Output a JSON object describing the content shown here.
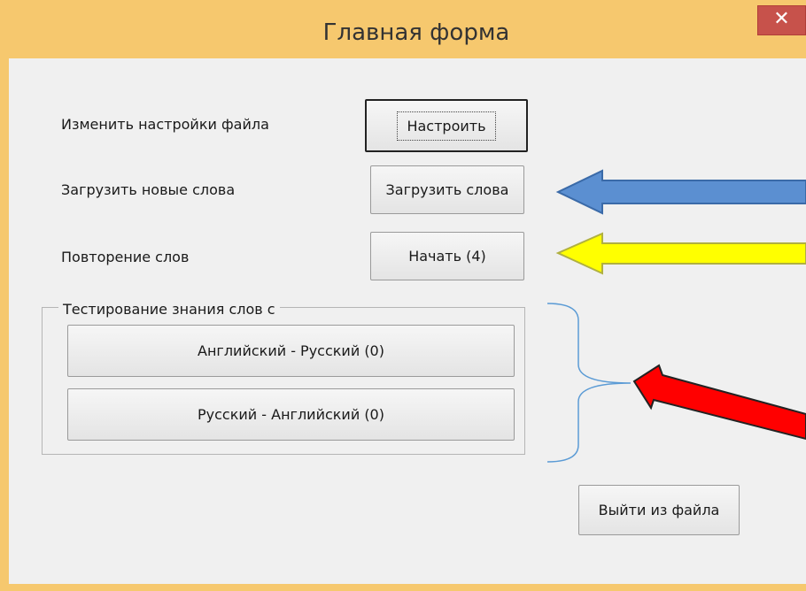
{
  "window": {
    "title": "Главная форма",
    "close_glyph": "✕"
  },
  "rows": {
    "settings_label": "Изменить настройки файла",
    "settings_button": "Настроить",
    "load_label": "Загрузить новые слова",
    "load_button": "Загрузить слова",
    "repeat_label": "Повторение слов",
    "repeat_button": "Начать (4)"
  },
  "test_group": {
    "legend": "Тестирование знания слов с",
    "en_ru_button": "Английский - Русский (0)",
    "ru_en_button": "Русский - Английский (0)"
  },
  "exit_button": "Выйти из файла",
  "annotations": {
    "blue_arrow_color": "#5b8fd1",
    "yellow_arrow_color": "#ffff00",
    "red_arrow_color": "#ff0000",
    "brace_color": "#5b9bd5"
  }
}
